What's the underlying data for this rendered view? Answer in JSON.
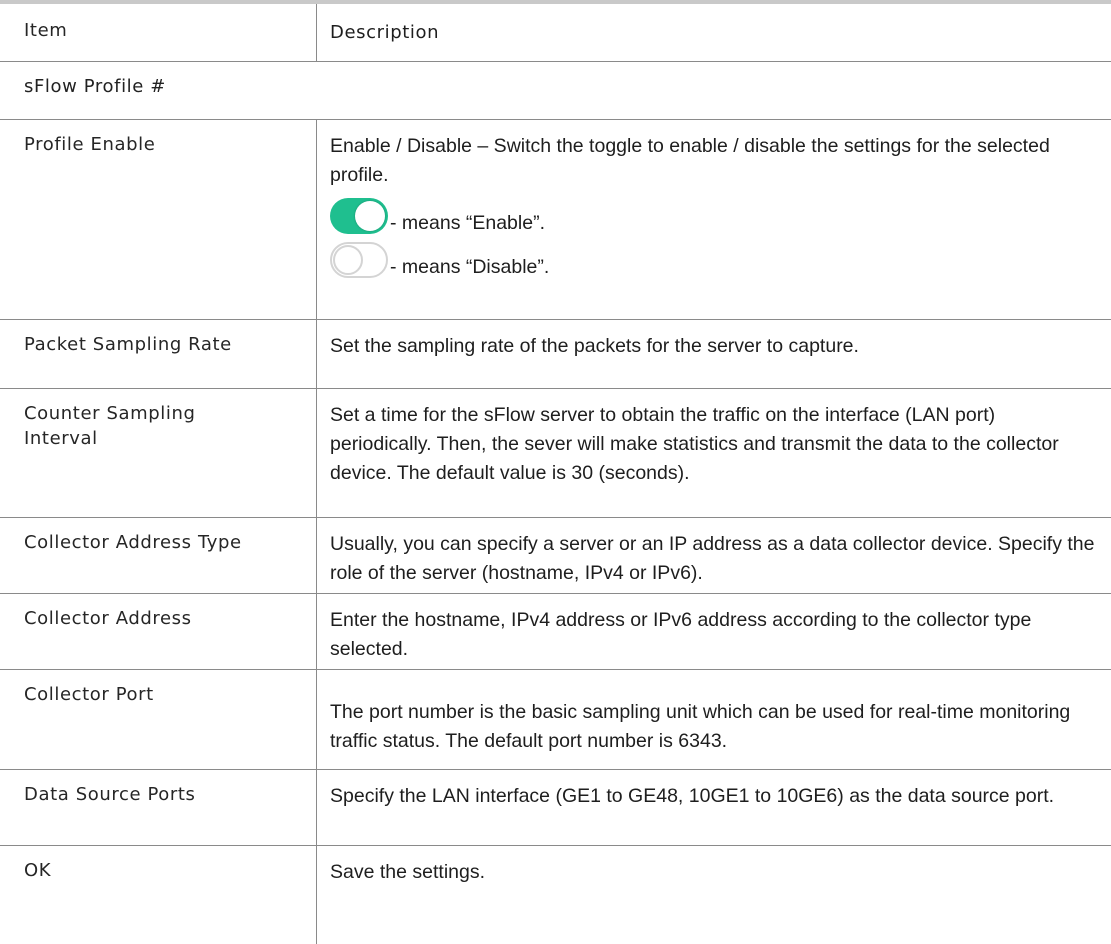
{
  "table": {
    "header": {
      "item": "Item",
      "description": "Description"
    },
    "section": "sFlow Profile #",
    "profile_enable": {
      "item": "Profile Enable",
      "description": "Enable / Disable – Switch the toggle to enable / disable the settings for the selected profile.",
      "enable_text": "- means “Enable”.",
      "disable_text": "- means “Disable”.",
      "toggle_on_color": "#1fbf8f",
      "toggle_off_color": "#d4d4d4"
    },
    "rows": [
      {
        "item": "Packet Sampling Rate",
        "description": "Set the sampling rate of the packets for the server to capture."
      },
      {
        "item_line1": "Counter Sampling",
        "item_line2": "Interval",
        "description": "Set a time for the sFlow server to obtain the traffic on the interface (LAN port) periodically. Then, the sever will make statistics and transmit the data to the collector device. The default value is 30 (seconds)."
      },
      {
        "item": "Collector Address Type",
        "description": "Usually, you can specify a server or an IP address as a data collector device. Specify the role of the server (hostname, IPv4 or IPv6)."
      },
      {
        "item": "Collector Address",
        "description": "Enter the hostname, IPv4 address or IPv6 address according to the collector type selected."
      },
      {
        "item": "Collector Port",
        "description": "The port number is the basic sampling unit which can be used for real-time monitoring traffic status. The default port number is 6343."
      },
      {
        "item": "Data Source Ports",
        "description": "Specify the LAN interface (GE1 to GE48, 10GE1 to 10GE6) as the data source port."
      },
      {
        "item": "OK",
        "description": "Save the settings."
      }
    ]
  }
}
